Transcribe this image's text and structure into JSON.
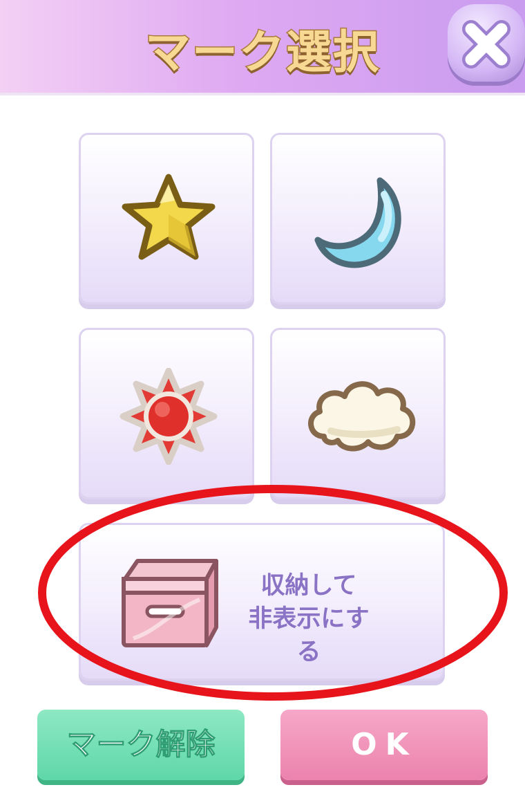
{
  "dialog": {
    "title": "マーク選択",
    "close_icon": "close-icon"
  },
  "marks": [
    {
      "name": "star",
      "icon": "star-icon",
      "color": "#f5d84a"
    },
    {
      "name": "moon",
      "icon": "moon-icon",
      "color": "#7fd3ee"
    },
    {
      "name": "sun",
      "icon": "sun-icon",
      "color": "#e23a34"
    },
    {
      "name": "cloud",
      "icon": "cloud-icon",
      "color": "#fbf6e8"
    }
  ],
  "storage_option": {
    "icon": "storage-box-icon",
    "label_line1": "収納して",
    "label_line2": "非表示にする"
  },
  "buttons": {
    "unmark_label": "マーク解除",
    "ok_label": "OK"
  },
  "colors": {
    "header_gradient": [
      "#f3d0f4",
      "#c99cef"
    ],
    "unmark_button": "#6ddcae",
    "ok_button": "#ee8ab2",
    "annotation_circle": "#e8141c"
  }
}
